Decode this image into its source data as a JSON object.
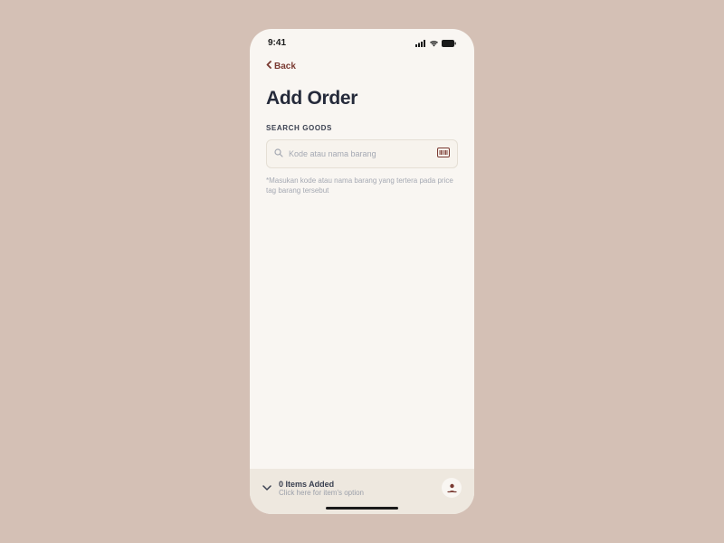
{
  "status": {
    "time": "9:41"
  },
  "nav": {
    "back_label": "Back"
  },
  "page": {
    "title": "Add Order"
  },
  "search": {
    "section_label": "SEARCH GOODS",
    "placeholder": "Kode atau nama barang",
    "helper": "*Masukan kode atau nama barang yang tertera pada price tag barang tersebut"
  },
  "bottom": {
    "title": "0 Items Added",
    "subtitle": "Click here for item's option"
  }
}
